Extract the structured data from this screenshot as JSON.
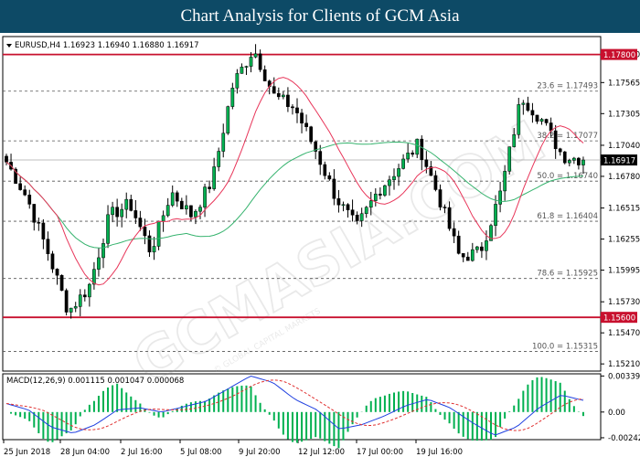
{
  "header": {
    "title": "Chart Analysis for Clients of GCM Asia"
  },
  "watermark": {
    "main": "GCMASIA.COM",
    "sub": "© GLOBAL CAPITAL MARKETS"
  },
  "chart_data": [
    {
      "type": "candlestick",
      "symbol_label": "EURUSD,H4",
      "ohlc_label": "1.16923 1.16940 1.16880 1.16917",
      "ylim": [
        1.1515,
        1.1795
      ],
      "yticks": [
        "1.17800",
        "1.17565",
        "1.17305",
        "1.17040",
        "1.16780",
        "1.16515",
        "1.16255",
        "1.15995",
        "1.15730",
        "1.15470",
        "1.15210"
      ],
      "xticks": [
        "25 Jun 2018",
        "28 Jun 04:00",
        "2 Jul 16:00",
        "5 Jul 08:00",
        "9 Jul 20:00",
        "12 Jul 12:00",
        "17 Jul 00:00",
        "19 Jul 16:00"
      ],
      "current_price": 1.16917,
      "current_price_label": "1.16917",
      "resistance": {
        "value": 1.178,
        "label": "1.17800"
      },
      "support": {
        "value": 1.156,
        "label": "1.15600"
      },
      "fib_levels": [
        {
          "value": 1.17493,
          "label": "23.6 = 1.17493"
        },
        {
          "value": 1.17077,
          "label": "38.2 = 1.17077"
        },
        {
          "value": 1.1674,
          "label": "50.0 = 1.16740"
        },
        {
          "value": 1.16404,
          "label": "61.8 = 1.16404"
        },
        {
          "value": 1.15925,
          "label": "78.6 = 1.15925"
        },
        {
          "value": 1.15315,
          "label": "100.0 = 1.15315"
        }
      ],
      "key_closes": [
        1.169,
        1.166,
        1.1615,
        1.1565,
        1.1585,
        1.1645,
        1.1655,
        1.1615,
        1.1665,
        1.1645,
        1.1675,
        1.1755,
        1.1785,
        1.1745,
        1.1735,
        1.17,
        1.166,
        1.1635,
        1.1665,
        1.1685,
        1.1705,
        1.166,
        1.161,
        1.1615,
        1.1665,
        1.1745,
        1.1725,
        1.1695,
        1.1692
      ],
      "colors": {
        "up": "#00b050",
        "down": "#000000",
        "level_line": "#c8102e",
        "ma_fast": "#e8365a",
        "ma_slow": "#36b36e"
      }
    },
    {
      "type": "macd",
      "label": "MACD(12,26,9) 0.001115 0.001047 0.000068",
      "yticks": [
        "0.003397",
        "0.00",
        "-0.002424"
      ],
      "ylim": [
        -0.0026,
        0.0036
      ],
      "key_values": [
        0.0008,
        0.0002,
        -0.0014,
        -0.002,
        -0.0012,
        0.0002,
        0.0004,
        0.0,
        0.0005,
        0.001,
        0.0022,
        0.0034,
        0.0028,
        0.0012,
        0.0002,
        -0.0016,
        -0.0012,
        -0.0004,
        0.0006,
        0.0012,
        0.0004,
        -0.001,
        -0.0022,
        -0.0014,
        0.0004,
        0.0016,
        0.0011
      ],
      "colors": {
        "macd": "#2040e0",
        "signal": "#e03030",
        "hist": "#00b050"
      }
    }
  ]
}
